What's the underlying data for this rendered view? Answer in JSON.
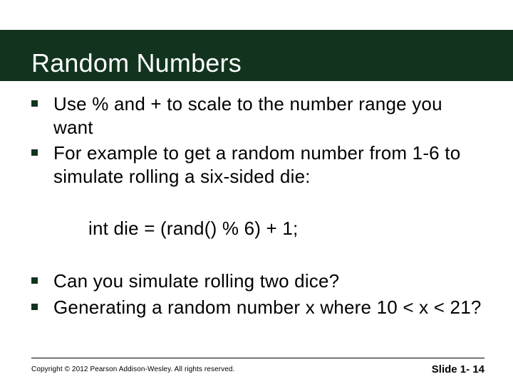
{
  "title": "Random Numbers",
  "bullets_a": [
    "Use % and + to scale to the number range you want",
    "For example to get a random number from 1-6 to simulate rolling a six-sided die:"
  ],
  "code": "int die = (rand() % 6) + 1;",
  "bullets_b": [
    "Can you simulate rolling two dice?",
    "Generating a random number x where 10 < x < 21?"
  ],
  "footer": {
    "copyright": "Copyright © 2012 Pearson Addison-Wesley. All rights reserved.",
    "slide": "Slide 1- 14"
  }
}
